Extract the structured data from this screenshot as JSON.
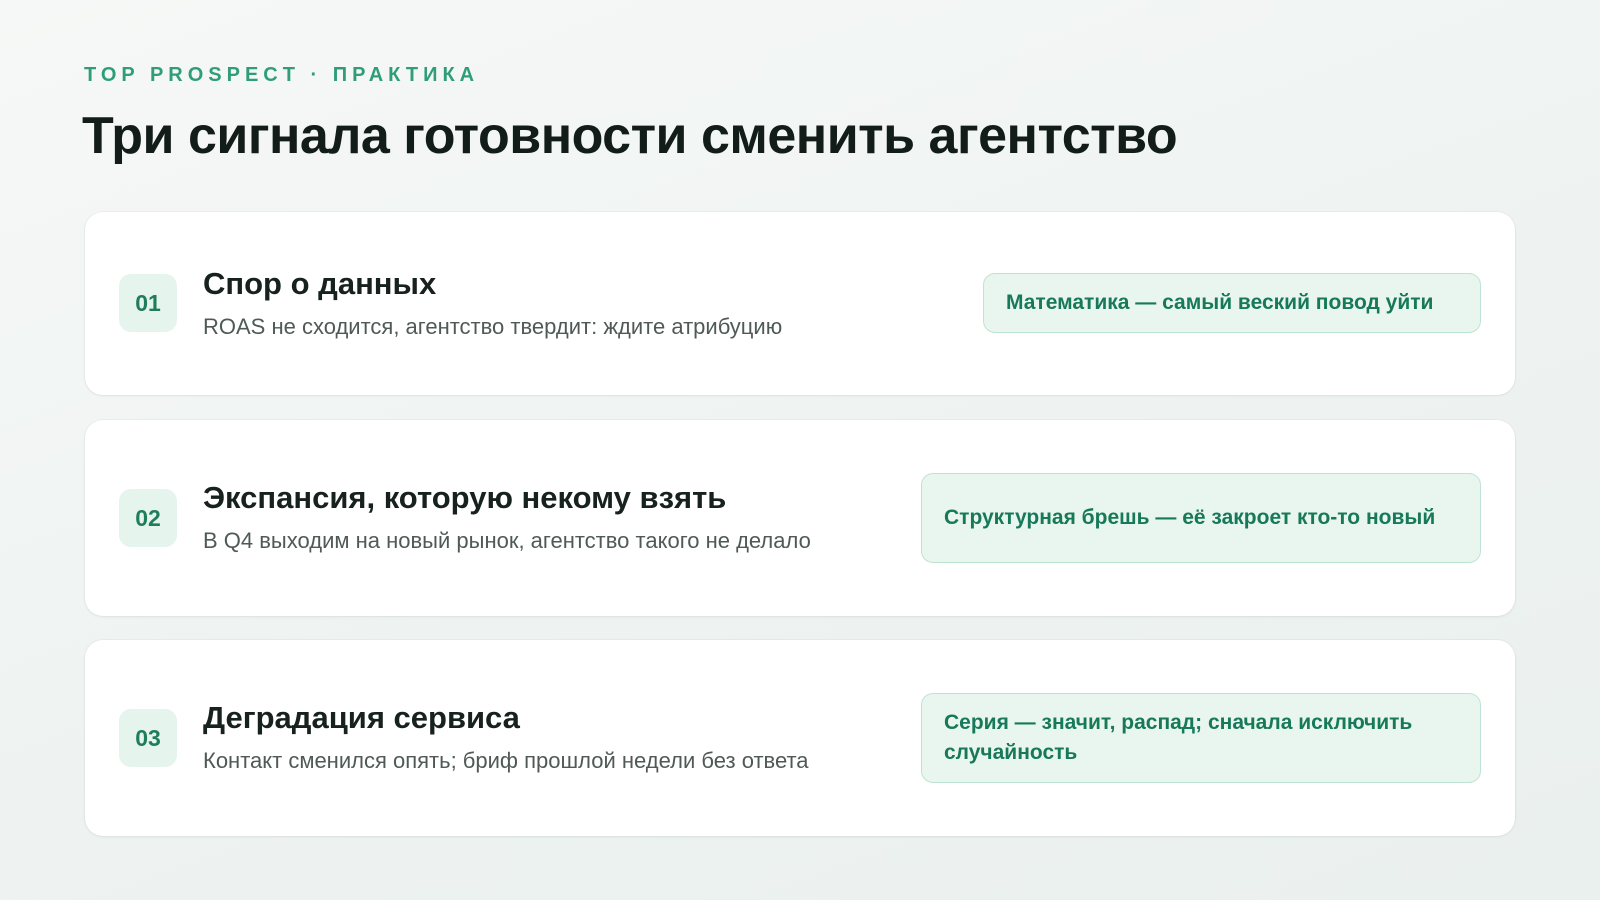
{
  "header": {
    "eyebrow": "TOP PROSPECT · ПРАКТИКА",
    "title": "Три сигнала готовности сменить агентство"
  },
  "signals": [
    {
      "number": "01",
      "title": "Спор о данных",
      "description": "ROAS не сходится, агентство твердит: ждите атрибуцию",
      "tag": "Математика — самый веский повод уйти"
    },
    {
      "number": "02",
      "title": "Экспансия, которую некому взять",
      "description": "В Q4 выходим на новый рынок, агентство такого не делало",
      "tag": "Структурная брешь — её закроет кто-то новый"
    },
    {
      "number": "03",
      "title": "Деградация сервиса",
      "description": "Контакт сменился опять; бриф прошлой недели без ответа",
      "tag": "Серия — значит, распад; сначала исключить случайность"
    }
  ],
  "colors": {
    "accent": "#2f9e78",
    "tag_background": "#e8f6ef",
    "tag_text": "#17795a",
    "number_badge": "#e6f4ee"
  }
}
